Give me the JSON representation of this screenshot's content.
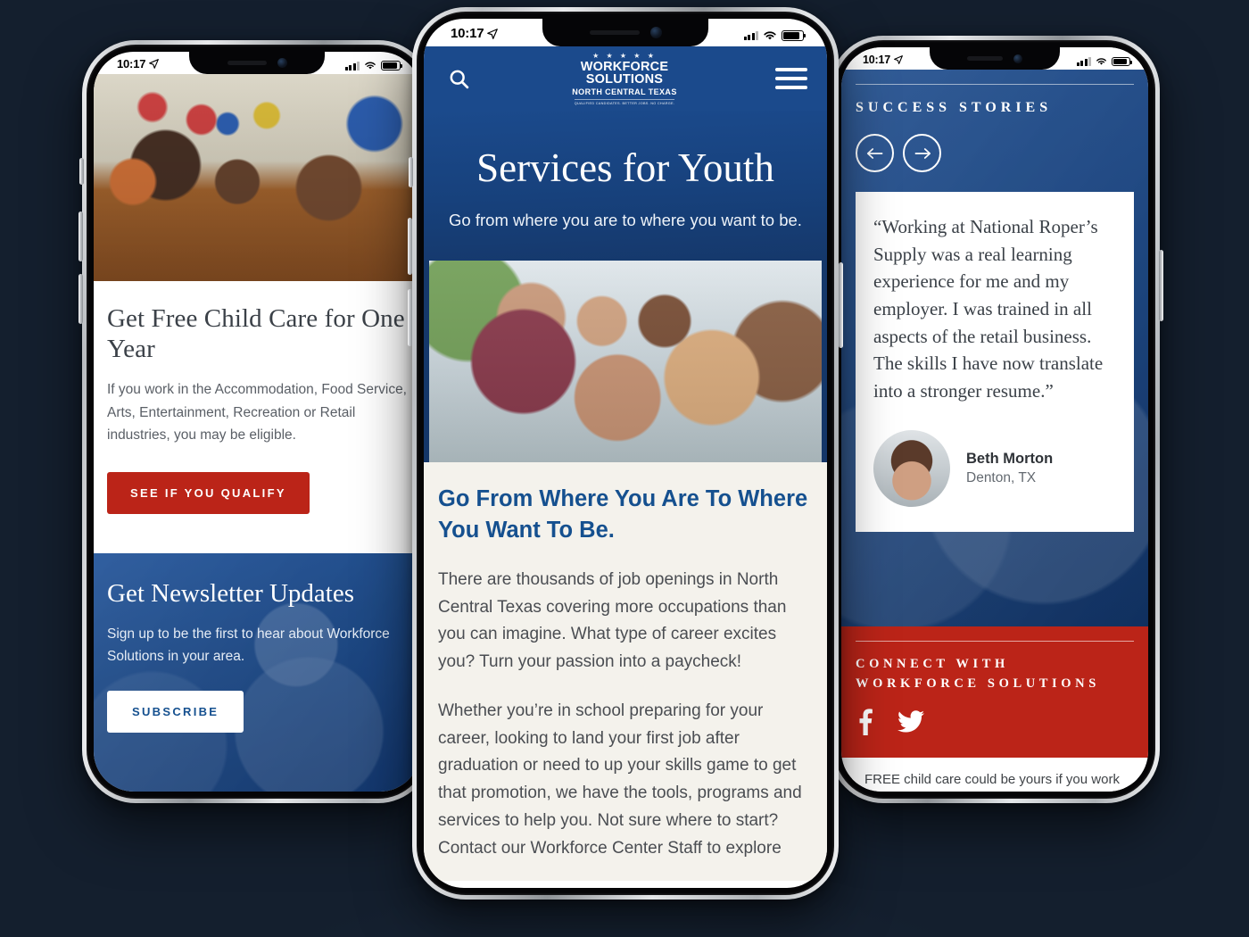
{
  "background_color": "#141f2e",
  "brand": {
    "blue": "#1b4a8c",
    "dark_blue": "#15508f",
    "red": "#bb2418",
    "paper": "#f4f2ec"
  },
  "status_bar": {
    "time": "10:17",
    "location_icon": "location-arrow-icon",
    "signal_icon": "cellular-bars-icon",
    "wifi_icon": "wifi-icon",
    "battery_icon": "battery-icon"
  },
  "logo": {
    "stars": "★ ★ ★ ★ ★",
    "line1": "WORKFORCE SOLUTIONS",
    "line2": "NORTH CENTRAL TEXAS",
    "tagline": "QUALIFIED CANDIDATES. BETTER JOBS. NO CHARGE."
  },
  "left_phone": {
    "hero_photo_alt": "teacher-and-children-classroom-photo",
    "card": {
      "title": "Get Free Child Care for One Year",
      "body": "If you work in the Accommodation, Food Service, Arts, Entertainment, Recreation or Retail industries, you may be eligible.",
      "cta": "SEE IF YOU QUALIFY"
    },
    "newsletter": {
      "title": "Get Newsletter Updates",
      "body": "Sign up to be the first to hear about Workforce Solutions in your area.",
      "cta": "SUBSCRIBE"
    }
  },
  "center_phone": {
    "nav": {
      "search_icon": "search-icon",
      "menu_icon": "hamburger-menu-icon"
    },
    "hero": {
      "title": "Services for Youth",
      "subtitle": "Go from where you are to where you want to be."
    },
    "photo_alt": "group-of-smiling-youth-photo",
    "section": {
      "heading": "Go From Where You Are To Where You Want To Be.",
      "paragraph1": "There are thousands of job openings in North Central Texas covering more occupations than you can imagine. What type of career excites you? Turn your passion into a paycheck!",
      "paragraph2": "Whether you’re in school preparing for your career, looking to land your first job after graduation or need to up your skills game to get that promotion, we have the tools, programs and services to help you. Not sure where to start? Contact our Workforce Center Staff to explore"
    }
  },
  "right_phone": {
    "stories": {
      "eyebrow": "SUCCESS STORIES",
      "prev_icon": "arrow-left-icon",
      "next_icon": "arrow-right-icon",
      "quote": "“Working at National Roper’s Supply was a real learning experience for me and my employer. I was trained in all aspects of the retail business. The skills I have now translate into a stronger resume.”",
      "author_photo_alt": "beth-morton-headshot",
      "author_name": "Beth Morton",
      "author_location": "Denton, TX"
    },
    "connect": {
      "eyebrow": "CONNECT WITH WORKFORCE SOLUTIONS",
      "facebook_icon": "facebook-icon",
      "twitter_icon": "twitter-icon"
    },
    "tweet": {
      "text": "FREE child care could be yours if you work in a hotel or restaurant! The @TXWorkforce has approved $500 million to help low-wage"
    }
  }
}
